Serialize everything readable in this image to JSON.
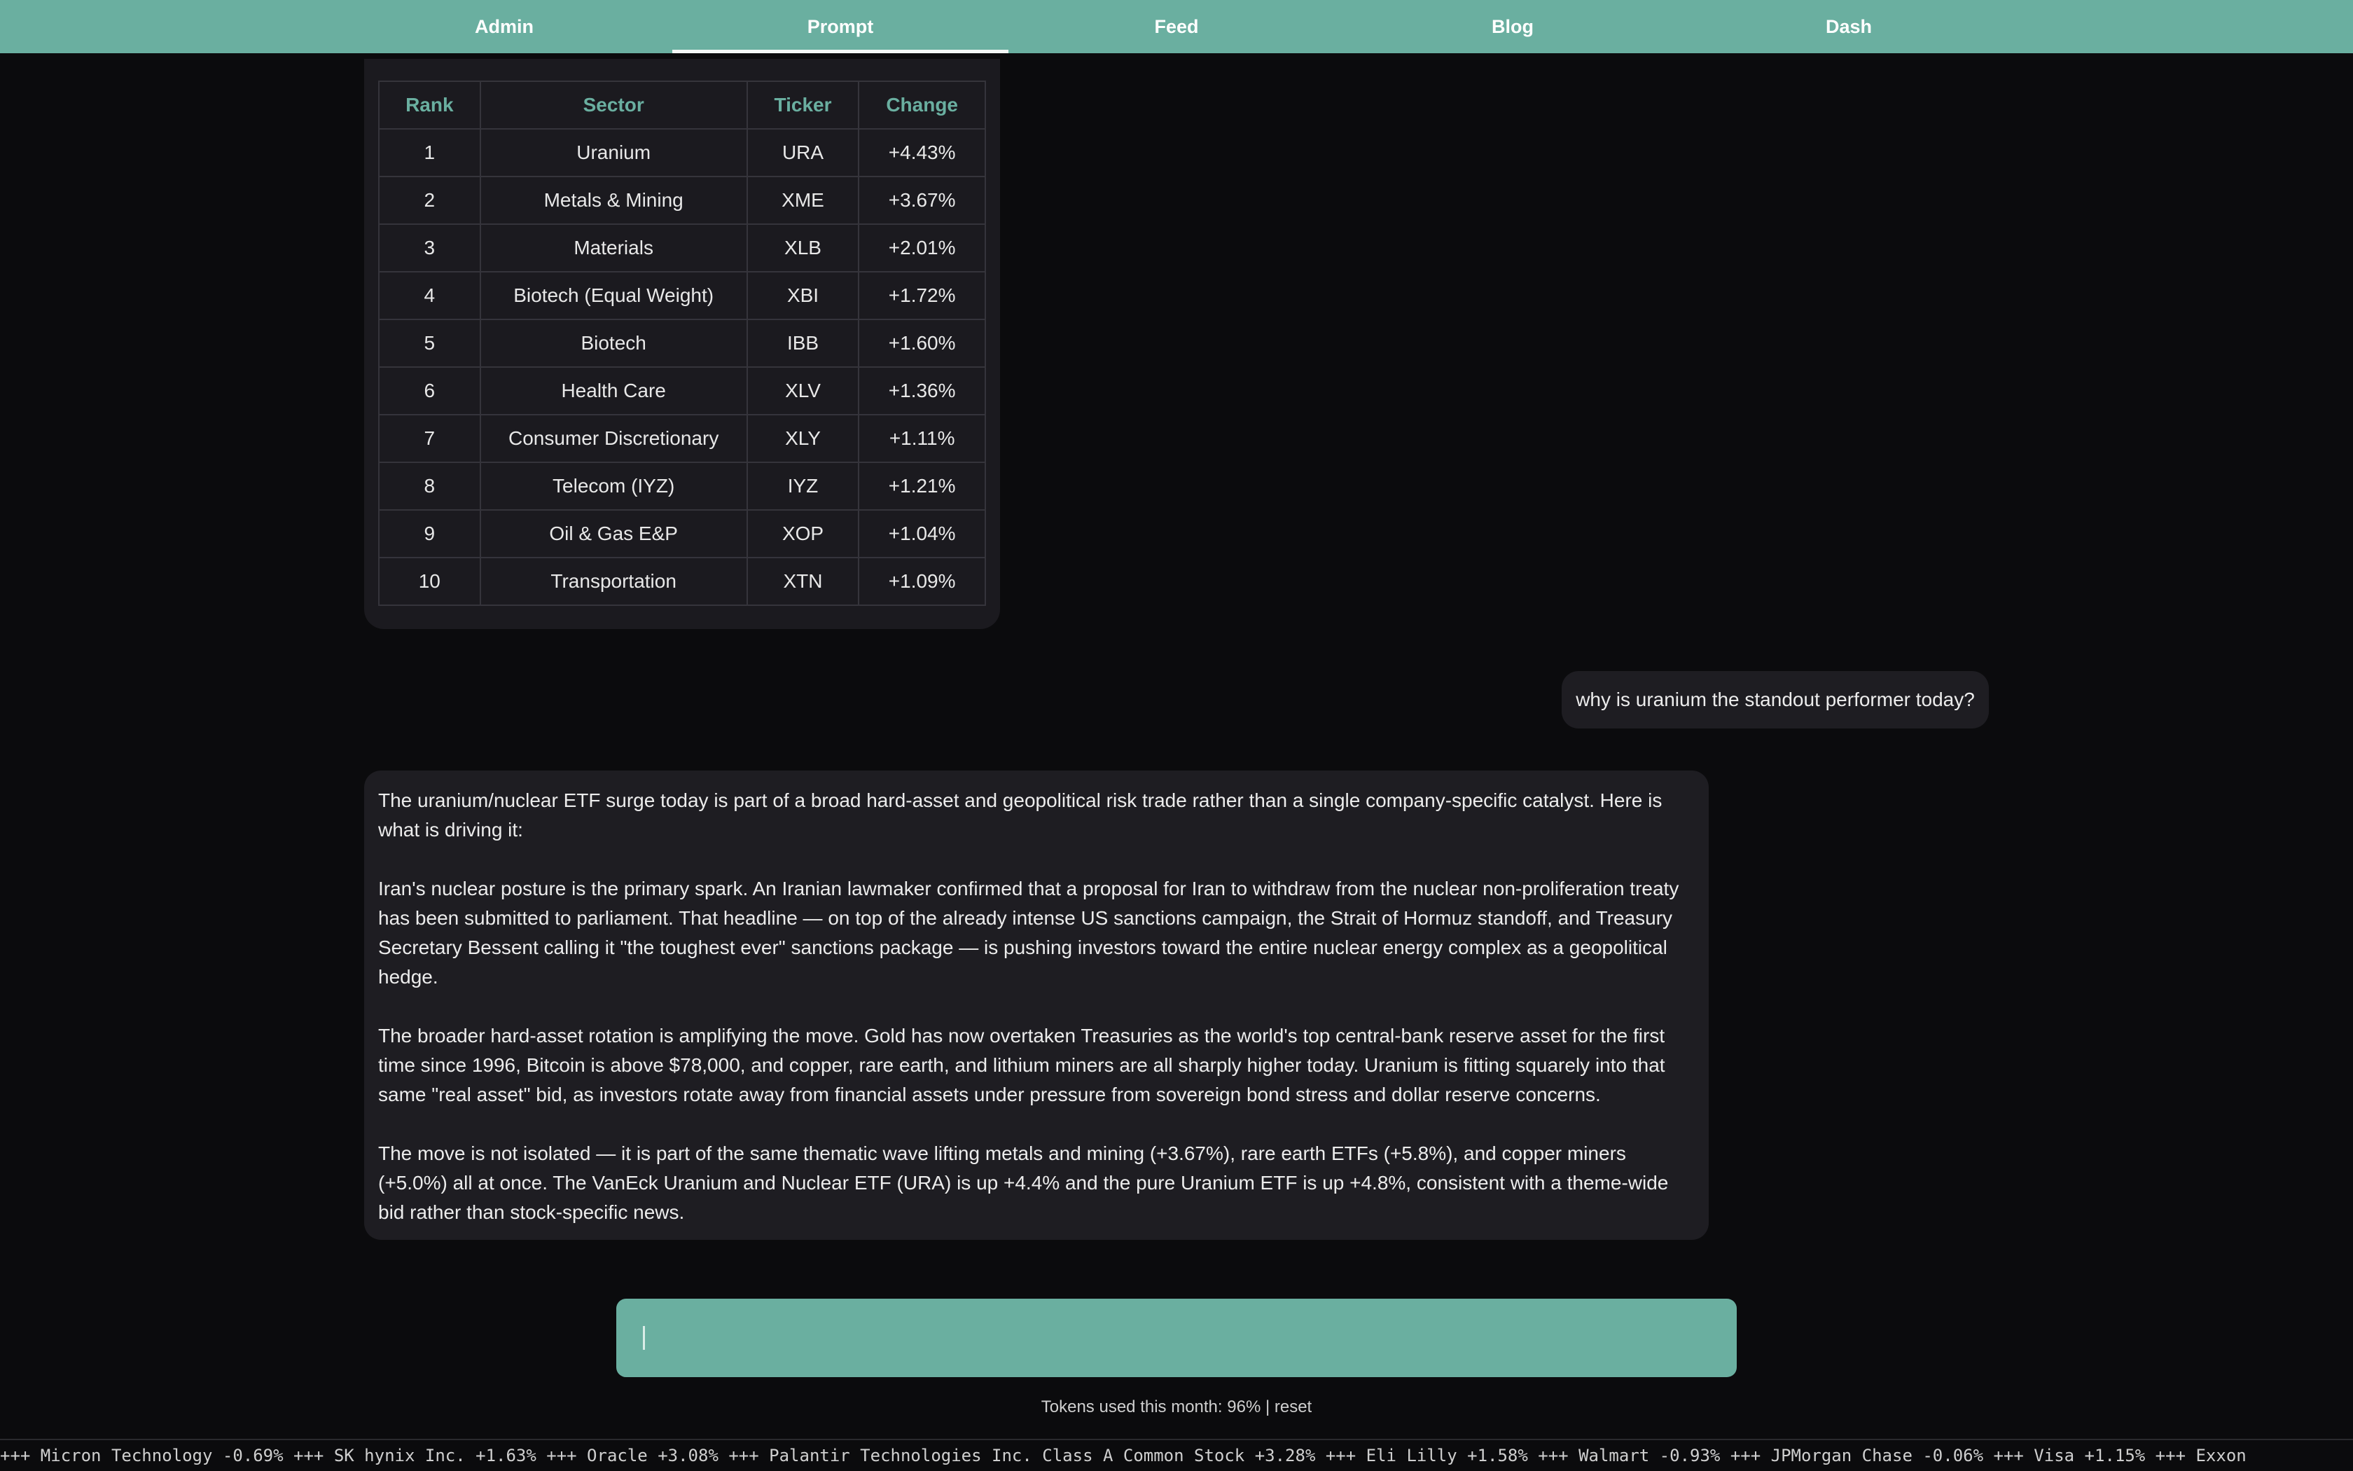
{
  "nav": {
    "tabs": [
      {
        "label": "Admin",
        "active": false
      },
      {
        "label": "Prompt",
        "active": true
      },
      {
        "label": "Feed",
        "active": false
      },
      {
        "label": "Blog",
        "active": false
      },
      {
        "label": "Dash",
        "active": false
      }
    ],
    "bar_color": "#6aafa0"
  },
  "table": {
    "headers": [
      "Rank",
      "Sector",
      "Ticker",
      "Change"
    ],
    "rows": [
      [
        "1",
        "Uranium",
        "URA",
        "+4.43%"
      ],
      [
        "2",
        "Metals & Mining",
        "XME",
        "+3.67%"
      ],
      [
        "3",
        "Materials",
        "XLB",
        "+2.01%"
      ],
      [
        "4",
        "Biotech (Equal Weight)",
        "XBI",
        "+1.72%"
      ],
      [
        "5",
        "Biotech",
        "IBB",
        "+1.60%"
      ],
      [
        "6",
        "Health Care",
        "XLV",
        "+1.36%"
      ],
      [
        "7",
        "Consumer Discretionary",
        "XLY",
        "+1.11%"
      ],
      [
        "8",
        "Telecom (IYZ)",
        "IYZ",
        "+1.21%"
      ],
      [
        "9",
        "Oil & Gas E&P",
        "XOP",
        "+1.04%"
      ],
      [
        "10",
        "Transportation",
        "XTN",
        "+1.09%"
      ]
    ]
  },
  "chat": {
    "user_message": "why is uranium the standout performer today?",
    "assistant_paragraphs": [
      "The uranium/nuclear ETF surge today is part of a broad hard-asset and geopolitical risk trade rather than a single company-specific catalyst. Here is what is driving it:",
      "Iran's nuclear posture is the primary spark. An Iranian lawmaker confirmed that a proposal for Iran to withdraw from the nuclear non-proliferation treaty has been submitted to parliament. That headline — on top of the already intense US sanctions campaign, the Strait of Hormuz standoff, and Treasury Secretary Bessent calling it \"the toughest ever\" sanctions package — is pushing investors toward the entire nuclear energy complex as a geopolitical hedge.",
      "The broader hard-asset rotation is amplifying the move. Gold has now overtaken Treasuries as the world's top central-bank reserve asset for the first time since 1996, Bitcoin is above $78,000, and copper, rare earth, and lithium miners are all sharply higher today. Uranium is fitting squarely into that same \"real asset\" bid, as investors rotate away from financial assets under pressure from sovereign bond stress and dollar reserve concerns.",
      "The move is not isolated — it is part of the same thematic wave lifting metals and mining (+3.67%), rare earth ETFs (+5.8%), and copper miners (+5.0%) all at once. The VanEck Uranium and Nuclear ETF (URA) is up +4.4% and the pure Uranium ETF is up +4.8%, consistent with a theme-wide bid rather than stock-specific news."
    ]
  },
  "prompt": {
    "value": "",
    "placeholder": ""
  },
  "tokens": {
    "text": "Tokens used this month: 96% | ",
    "reset_label": "reset"
  },
  "ticker": {
    "text": "+++  Micron Technology -0.69%  +++  SK hynix Inc. +1.63%  +++  Oracle +3.08%  +++  Palantir Technologies Inc. Class A Common Stock +3.28%  +++  Eli Lilly +1.58%  +++  Walmart -0.93%  +++  JPMorgan Chase -0.06%  +++  Visa +1.15%  +++  Exxon"
  }
}
